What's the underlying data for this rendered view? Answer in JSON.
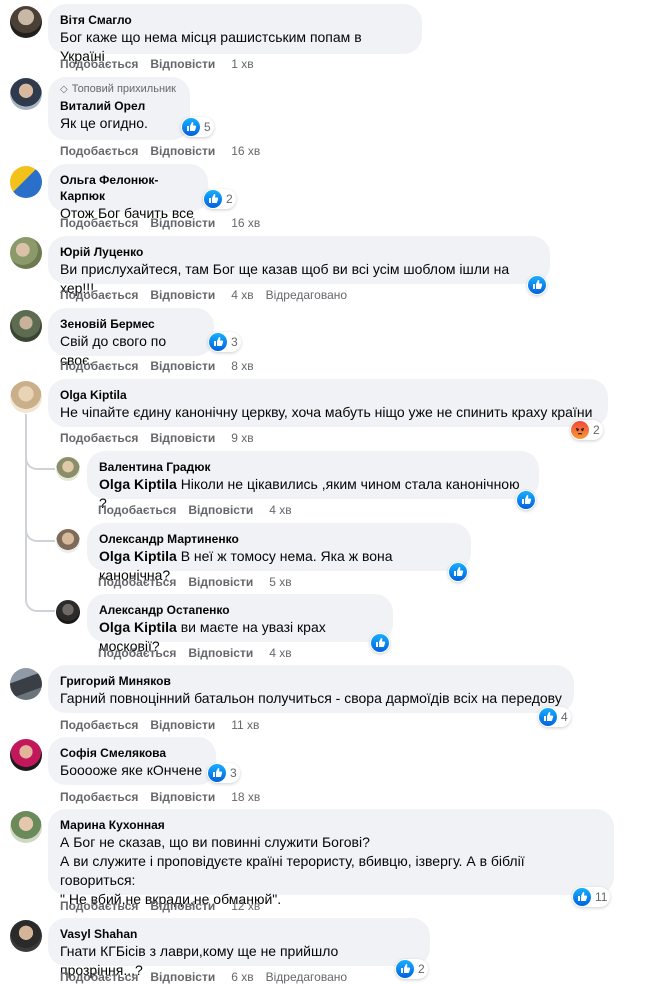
{
  "labels": {
    "like": "Подобається",
    "reply": "Відповісти",
    "edited": "Відредаговано",
    "top_fan": "Топовий прихильник"
  },
  "comments": [
    {
      "author": "Вітя Смагло",
      "text": "Бог каже що нема місця рашистським попам в Україні",
      "time": "1 хв"
    },
    {
      "author": "Виталий Орел",
      "text": "Як це огидно.",
      "time": "16 хв",
      "reactions": "5"
    },
    {
      "author": "Ольга Фелонюк-Карпюк",
      "text": "Отож Бог бачить все",
      "time": "16 хв",
      "reactions": "2"
    },
    {
      "author": "Юрій Луценко",
      "text": "Ви прислухайтеся, там Бог ще казав щоб ви всі усім шоблом ішли на хер!!!",
      "time": "4 хв"
    },
    {
      "author": "Зеновій Бермес",
      "text": "Свій до свого по своє.",
      "time": "8 хв",
      "reactions": "3"
    },
    {
      "author": "Olga Kiptila",
      "text": "Не чіпайте єдину канонічну церкву, хоча мабуть ніщо уже не спинить краху країни",
      "time": "9 хв",
      "reactions": "2"
    },
    {
      "author": "Валентина Градюк",
      "mention": "Olga Kiptila",
      "text": "Ніколи не цікавились ,яким чином стала канонічною ?",
      "time": "4 хв"
    },
    {
      "author": "Олександр Мартиненко",
      "mention": "Olga Kiptila",
      "text": "В неї ж томосу нема. Яка ж вона канонічна?",
      "time": "5 хв"
    },
    {
      "author": "Александр Остапенко",
      "mention": "Olga Kiptila",
      "text": "ви маєте на увазі крах московії?",
      "time": "4 хв"
    },
    {
      "author": "Григорий Миняков",
      "text": "Гарний повноцінний батальон получиться - свора дармоїдів всіх на передову",
      "time": "11 хв",
      "reactions": "4"
    },
    {
      "author": "Софія Смелякова",
      "text": "Бооооже яке кОнчене",
      "time": "18 хв",
      "reactions": "3"
    },
    {
      "author": "Марина Кухонная",
      "text": "А Бог не сказав, що ви повинні служити Богові?\nА ви служите і проповідуєте країні терористу, вбивцю, ізвергу. А в біблії говориться:\n\" Не вбий,не вкради,не обманюй\".",
      "time": "12 хв",
      "reactions": "11"
    },
    {
      "author": "Vasyl Shahan",
      "text": "Гнати КГБісів з лаври,кому ще не прийшло прозріння...?",
      "time": "6 хв",
      "reactions": "2"
    }
  ],
  "colors": {
    "bubble": "#f0f2f5",
    "meta_text": "#65676b",
    "like_blue": "#1877f2",
    "thread_line": "#cfd2d6"
  }
}
